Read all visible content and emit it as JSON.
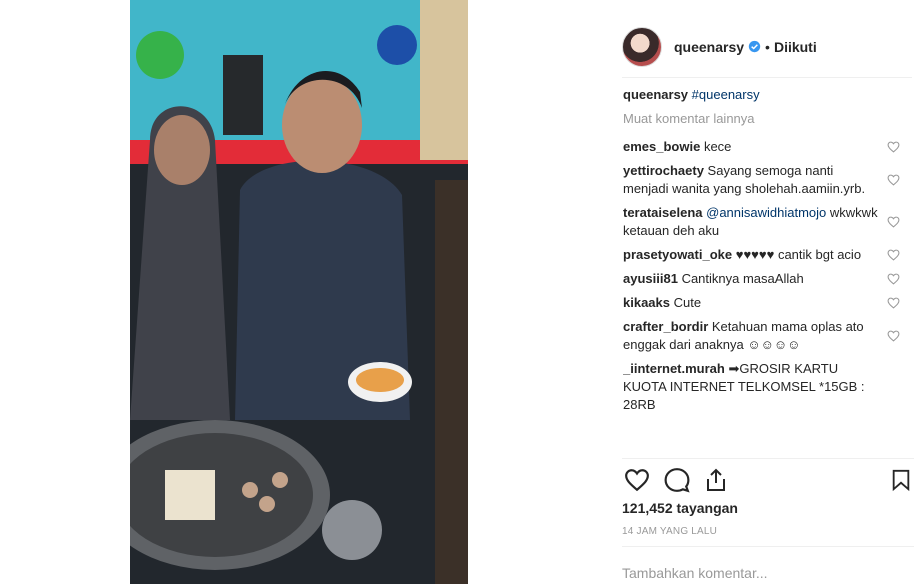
{
  "post": {
    "username": "queenarsy",
    "follow_label": "Diikuti",
    "caption_user": "queenarsy",
    "caption_tag": "#queenarsy",
    "load_more": "Muat komentar lainnya",
    "views": "121,452 tayangan",
    "timestamp": "14 JAM YANG LALU",
    "add_comment_placeholder": "Tambahkan komentar..."
  },
  "comments": [
    {
      "user": "emes_bowie",
      "text": "kece"
    },
    {
      "user": "yettirochaety",
      "text": "Sayang semoga nanti menjadi wanita yang sholehah.aamiin.yrb."
    },
    {
      "user": "terataiselena",
      "mention": "@annisawidhiatmojo",
      "text": "wkwkwk ketauan deh aku"
    },
    {
      "user": "prasetyowati_oke",
      "text": "♥♥♥♥♥ cantik bgt acio"
    },
    {
      "user": "ayusiii81",
      "text": "Cantiknya masaAllah"
    },
    {
      "user": "kikaaks",
      "text": "Cute"
    },
    {
      "user": "crafter_bordir",
      "text": "Ketahuan mama oplas ato enggak dari anaknya ☺☺☺☺"
    },
    {
      "user": "_iinternet.murah",
      "text": "➡GROSIR KARTU KUOTA INTERNET TELKOMSEL *15GB : 28RB"
    }
  ],
  "icons": {
    "heart": "heart-icon",
    "comment": "comment-icon",
    "share": "share-icon",
    "save": "bookmark-icon",
    "verified": "verified-badge-icon"
  },
  "colors": {
    "text": "#262626",
    "muted": "#999999",
    "link": "#003569",
    "verified": "#3897f0"
  }
}
